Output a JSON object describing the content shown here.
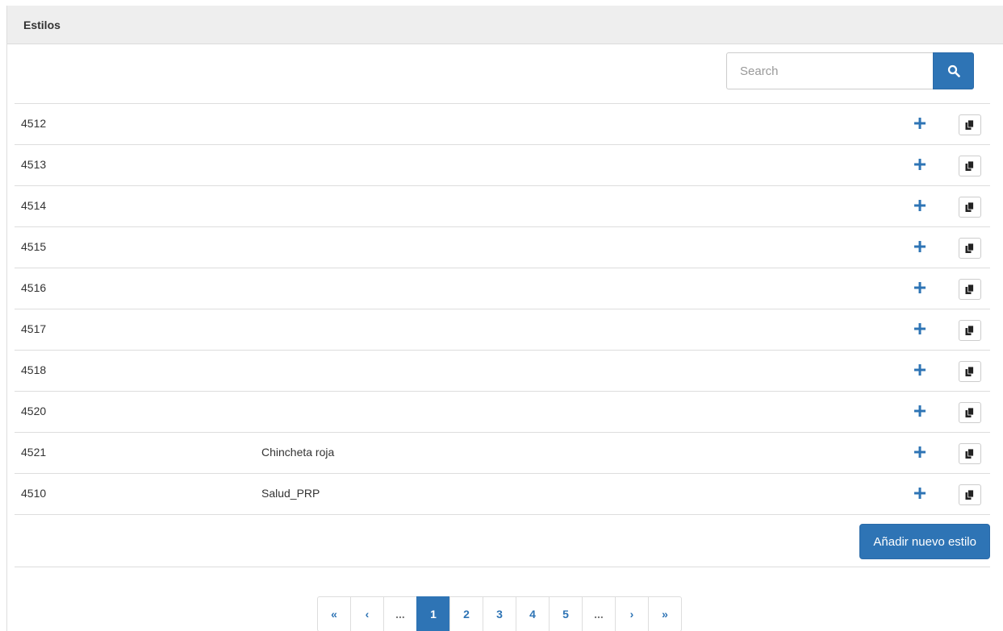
{
  "panel": {
    "title": "Estilos"
  },
  "search": {
    "placeholder": "Search",
    "value": "",
    "button_icon": "search-icon"
  },
  "colors": {
    "accent": "#2e74b5",
    "heading_bg": "#eeeeee"
  },
  "rows": [
    {
      "id": "4512",
      "name": ""
    },
    {
      "id": "4513",
      "name": ""
    },
    {
      "id": "4514",
      "name": ""
    },
    {
      "id": "4515",
      "name": ""
    },
    {
      "id": "4516",
      "name": ""
    },
    {
      "id": "4517",
      "name": ""
    },
    {
      "id": "4518",
      "name": ""
    },
    {
      "id": "4520",
      "name": ""
    },
    {
      "id": "4521",
      "name": "Chincheta roja"
    },
    {
      "id": "4510",
      "name": "Salud_PRP"
    }
  ],
  "row_actions": {
    "add_icon": "plus-icon",
    "copy_icon": "copy-icon"
  },
  "footer": {
    "add_button_label": "Añadir nuevo estilo"
  },
  "pagination": {
    "items": [
      {
        "label": "«",
        "kind": "first"
      },
      {
        "label": "‹",
        "kind": "prev"
      },
      {
        "label": "...",
        "kind": "ellipsis"
      },
      {
        "label": "1",
        "kind": "page",
        "active": true
      },
      {
        "label": "2",
        "kind": "page"
      },
      {
        "label": "3",
        "kind": "page"
      },
      {
        "label": "4",
        "kind": "page"
      },
      {
        "label": "5",
        "kind": "page"
      },
      {
        "label": "...",
        "kind": "ellipsis"
      },
      {
        "label": "›",
        "kind": "next"
      },
      {
        "label": "»",
        "kind": "last"
      }
    ]
  }
}
